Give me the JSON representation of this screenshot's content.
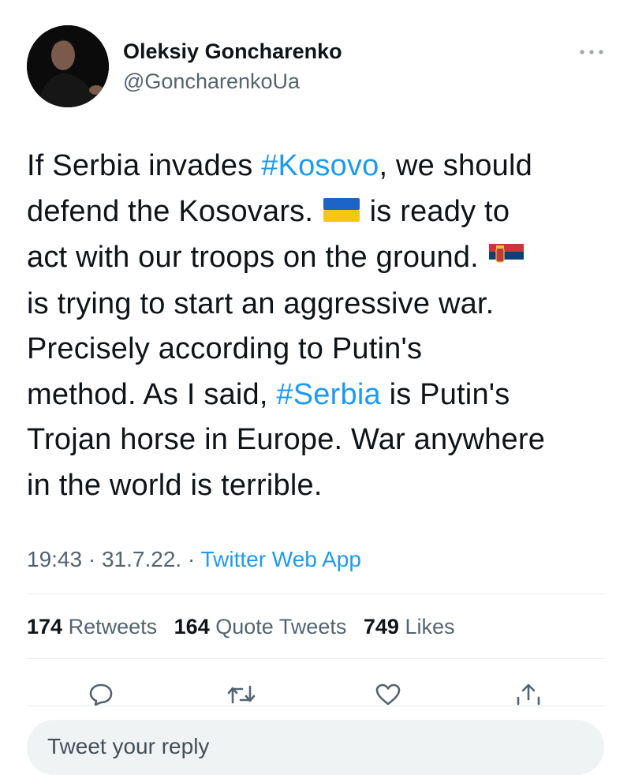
{
  "author": {
    "name": "Oleksiy Goncharenko",
    "handle": "@GoncharenkoUa"
  },
  "tweet": {
    "lines": [
      [
        {
          "text": "If Serbia invades "
        },
        {
          "text": "#Kosovo",
          "link": true
        },
        {
          "text": ", we should"
        }
      ],
      [
        {
          "text": "defend the Kosovars. "
        },
        {
          "flag": "ukraine"
        },
        {
          "text": " is ready to"
        }
      ],
      [
        {
          "text": "act with our troops on the ground. "
        },
        {
          "flag": "serbia"
        }
      ],
      [
        {
          "text": "is trying to start an aggressive war."
        }
      ],
      [
        {
          "text": "Precisely according to Putin's"
        }
      ],
      [
        {
          "text": "method. As I said, "
        },
        {
          "text": "#Serbia",
          "link": true
        },
        {
          "text": " is Putin's"
        }
      ],
      [
        {
          "text": "Trojan horse in Europe. War anywhere"
        }
      ],
      [
        {
          "text": "in the world is terrible."
        }
      ]
    ]
  },
  "meta": {
    "time": "19:43",
    "date": "31.7.22.",
    "separator": "·",
    "source": "Twitter Web App"
  },
  "stats": {
    "retweets_count": "174",
    "retweets_label": "Retweets",
    "quotes_count": "164",
    "quotes_label": "Quote Tweets",
    "likes_count": "749",
    "likes_label": "Likes"
  },
  "actions": {
    "icons": [
      "reply-icon",
      "retweet-icon",
      "like-icon",
      "share-icon"
    ]
  },
  "reply": {
    "placeholder": "Tweet your reply"
  },
  "colors": {
    "link": "#1d9bf0",
    "text": "#0f1419",
    "secondary": "#536471",
    "reply_box": "#eff3f4"
  }
}
